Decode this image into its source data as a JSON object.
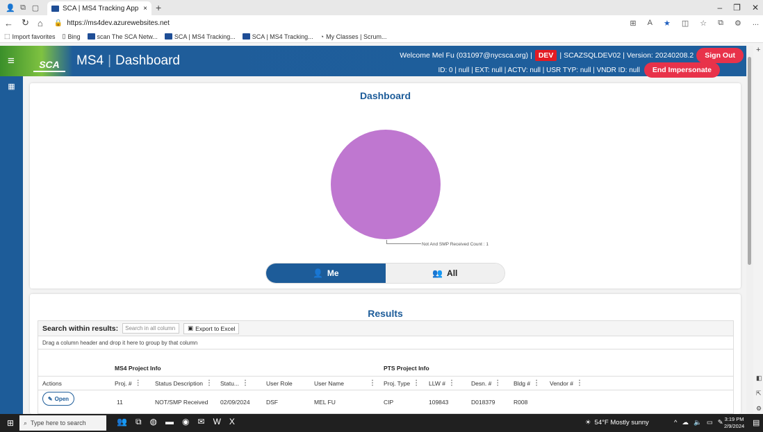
{
  "browser": {
    "tab_title": "SCA | MS4 Tracking App",
    "tab_close": "×",
    "new_tab": "+",
    "url": "https://ms4dev.azurewebsites.net",
    "favorites": [
      "Import favorites",
      "Bing",
      "scan The SCA Netw...",
      "SCA | MS4 Tracking...",
      "SCA | MS4 Tracking...",
      "My Classes | Scrum..."
    ],
    "more": "..."
  },
  "app": {
    "logo_text": "SCA",
    "app_name": "MS4",
    "page_name": "Dashboard",
    "welcome": "Welcome Mel Fu (031097@nycsca.org) |",
    "env_badge": "DEV",
    "server_info": "| SCAZSQLDEV02 | Version: 20240208.2",
    "sign_out": "Sign Out",
    "impersonation_info": "ID: 0 | null | EXT: null | ACTV: null | USR TYP: null | VNDR ID: null",
    "end_impersonate": "End Impersonate"
  },
  "dashboard": {
    "title": "Dashboard",
    "pie_label": "Not And SMP Received Count : 1",
    "pie_color": "#bf77d0",
    "toggle_me": "Me",
    "toggle_all": "All"
  },
  "results": {
    "title": "Results",
    "search_label": "Search within results:",
    "search_placeholder": "Search in all column",
    "export_label": "Export to Excel",
    "group_hint": "Drag a column header and drop it here to group by that column",
    "group_ms4": "MS4 Project Info",
    "group_pts": "PTS Project Info",
    "columns": [
      "Actions",
      "Proj. #",
      "Status Description",
      "Statu...",
      "User Role",
      "User Name",
      "Proj. Type",
      "LLW #",
      "Desn. #",
      "Bldg #",
      "Vendor #"
    ],
    "rows": [
      {
        "action": "Open",
        "proj": "11",
        "status": "NOT/SMP Received",
        "date": "02/09/2024",
        "role": "DSF",
        "user": "MEL FU",
        "ptype": "CIP",
        "llw": "109843",
        "desn": "D018379",
        "bldg": "R008",
        "vendor": ""
      }
    ]
  },
  "taskbar": {
    "search_placeholder": "Type here to search",
    "weather": "54°F  Mostly sunny",
    "time": "3:19 PM",
    "date": "2/9/2024"
  }
}
